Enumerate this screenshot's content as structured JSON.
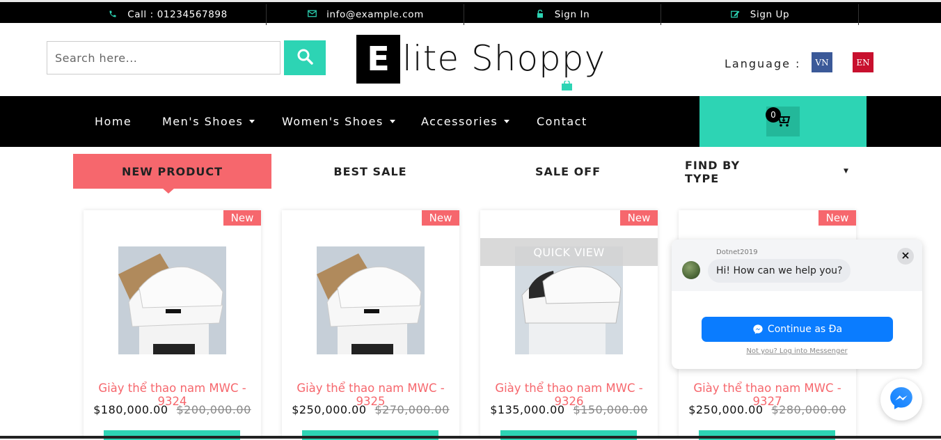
{
  "topbar": {
    "call": "Call : 01234567898",
    "email": "info@example.com",
    "signin": "Sign In",
    "signup": "Sign Up"
  },
  "header": {
    "search_placeholder": "Search here...",
    "logo_letter": "E",
    "logo_text": "lite Shoppy",
    "language_label": "Language :",
    "lang_vn": "VN",
    "lang_en": "EN",
    "lang_vn_color": "#3b5998",
    "lang_en_color": "#c8102e"
  },
  "nav": {
    "items": [
      {
        "label": "Home"
      },
      {
        "label": "Men's Shoes"
      },
      {
        "label": "Women's Shoes"
      },
      {
        "label": "Accessories"
      },
      {
        "label": "Contact"
      }
    ],
    "cart_count": "0"
  },
  "tabs": {
    "new_product": "NEW PRODUCT",
    "best_sale": "BEST SALE",
    "sale_off": "SALE OFF",
    "find_by_type": "FIND BY TYPE"
  },
  "products": [
    {
      "badge": "New",
      "name": "Giày thể thao nam MWC - 9324",
      "price": "$180,000.00",
      "old_price": "$200,000.00"
    },
    {
      "badge": "New",
      "name": "Giày thể thao nam MWC - 9325",
      "price": "$250,000.00",
      "old_price": "$270,000.00"
    },
    {
      "badge": "New",
      "name": "Giày thể thao nam MWC - 9326",
      "price": "$135,000.00",
      "old_price": "$150,000.00",
      "quick_view": "QUICK VIEW"
    },
    {
      "badge": "New",
      "name": "Giày thể thao nam MWC - 9327",
      "price": "$250,000.00",
      "old_price": "$280,000.00"
    }
  ],
  "chat": {
    "page_name": "Dotnet2019",
    "greeting": "Hi! How can we help you?",
    "continue_label": "Continue as Đa",
    "not_you": "Not you? Log into Messenger"
  },
  "colors": {
    "accent": "#2dd4b4",
    "sale": "#f6676d",
    "messenger": "#0a7cff"
  }
}
